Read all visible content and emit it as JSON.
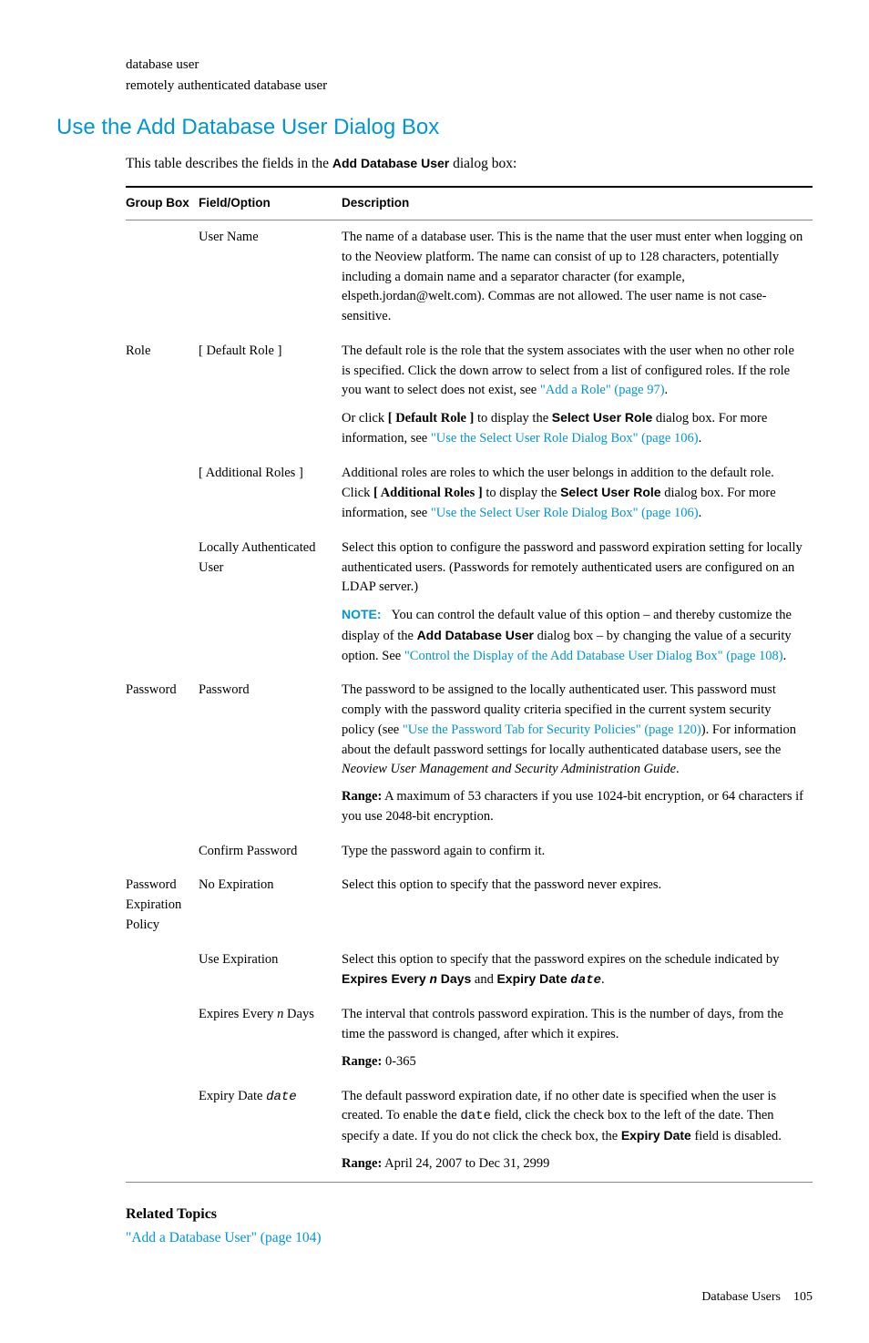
{
  "top": {
    "line1": "database user",
    "line2": "remotely authenticated database user"
  },
  "heading": "Use the Add Database User Dialog Box",
  "intro_pre": "This table describes the fields in the ",
  "intro_bold": "Add Database User",
  "intro_post": " dialog box:",
  "headers": {
    "c1": "Group Box",
    "c2": "Field/Option",
    "c3": "Description"
  },
  "rows": {
    "r1_f": "User Name",
    "r1_d": "The name of a database user. This is the name that the user must enter when logging on to the Neoview platform. The name can consist of up to 128 characters, potentially including a domain name and a separator character (for example, elspeth.jordan@welt.com). Commas are not allowed. The user name is not case-sensitive.",
    "r2_g": "Role",
    "r2_f": "[ Default Role ]",
    "r2_d1": "The default role is the role that the system associates with the user when no other role is specified. Click the down arrow to select from a list of configured roles. If the role you want to select does not exist, see ",
    "r2_link1": "\"Add a Role\" (page 97)",
    "r2_d2a": "Or click ",
    "r2_d2b": "[ Default Role ]",
    "r2_d2c": " to display the ",
    "r2_d2d": "Select User Role",
    "r2_d2e": " dialog box. For more information, see ",
    "r2_link2": "\"Use the Select User Role Dialog Box\" (page 106)",
    "r3_f": "[ Additional Roles ]",
    "r3_d1": "Additional roles are roles to which the user belongs in addition to the default role. Click ",
    "r3_d2": "[ Additional Roles ]",
    "r3_d3": " to display the ",
    "r3_d4": "Select User Role",
    "r3_d5": " dialog box. For more information, see ",
    "r3_link": "\"Use the Select User Role Dialog Box\" (page 106)",
    "r4_f": "Locally Authenticated User",
    "r4_d1": "Select this option to configure the password and password expiration setting for locally authenticated users. (Passwords for remotely authenticated users are configured on an LDAP server.)",
    "r4_note": "NOTE:",
    "r4_d2a": "You can control the default value of this option – and thereby customize the display of the ",
    "r4_d2b": "Add Database User",
    "r4_d2c": " dialog box – by changing the value of a security option. See ",
    "r4_link": "\"Control the Display of the Add Database User Dialog Box\" (page 108)",
    "r5_g": "Password",
    "r5_f": "Password",
    "r5_d1a": "The password to be assigned to the locally authenticated user. This password must comply with the password quality criteria specified in the current system security policy (see ",
    "r5_link": "\"Use the Password Tab for Security Policies\" (page 120)",
    "r5_d1b": "). For information about the default password settings for locally authenticated database users, see the ",
    "r5_d1c": "Neoview User Management and Security Administration Guide",
    "r5_rangelabel": "Range:",
    "r5_d2": " A maximum of 53 characters if you use 1024-bit encryption, or 64 characters if you use 2048-bit encryption.",
    "r6_f": "Confirm Password",
    "r6_d": "Type the password again to confirm it.",
    "r7_g": "Password Expiration Policy",
    "r7_f": "No Expiration",
    "r7_d": "Select this option to specify that the password never expires.",
    "r8_f": "Use Expiration",
    "r8_d1": "Select this option to specify that the password expires on the schedule indicated by ",
    "r8_d2": "Expires Every ",
    "r8_n": "n",
    "r8_d3": " Days",
    "r8_d4": " and ",
    "r8_d5": "Expiry Date ",
    "r8_date": "date",
    "r9_f1": "Expires Every ",
    "r9_fn": "n",
    "r9_f2": " Days",
    "r9_d1": "The interval that controls password expiration. This is the number of days, from the time the password is changed, after which it expires.",
    "r9_rangelabel": "Range:",
    "r9_d2": " 0-365",
    "r10_f1": "Expiry Date ",
    "r10_f2": "date",
    "r10_d1a": "The default password expiration date, if no other date is specified when the user is created. To enable the ",
    "r10_d1b": "date",
    "r10_d1c": " field, click the check box to the left of the date. Then specify a date. If you do not click the check box, the ",
    "r10_d1d": "Expiry Date",
    "r10_d1e": " field is disabled.",
    "r10_rangelabel": "Range:",
    "r10_d2": " April 24, 2007 to Dec 31, 2999"
  },
  "related": {
    "heading": "Related Topics",
    "link": "\"Add a Database User\" (page 104)"
  },
  "footer": {
    "section": "Database Users",
    "page": "105"
  }
}
